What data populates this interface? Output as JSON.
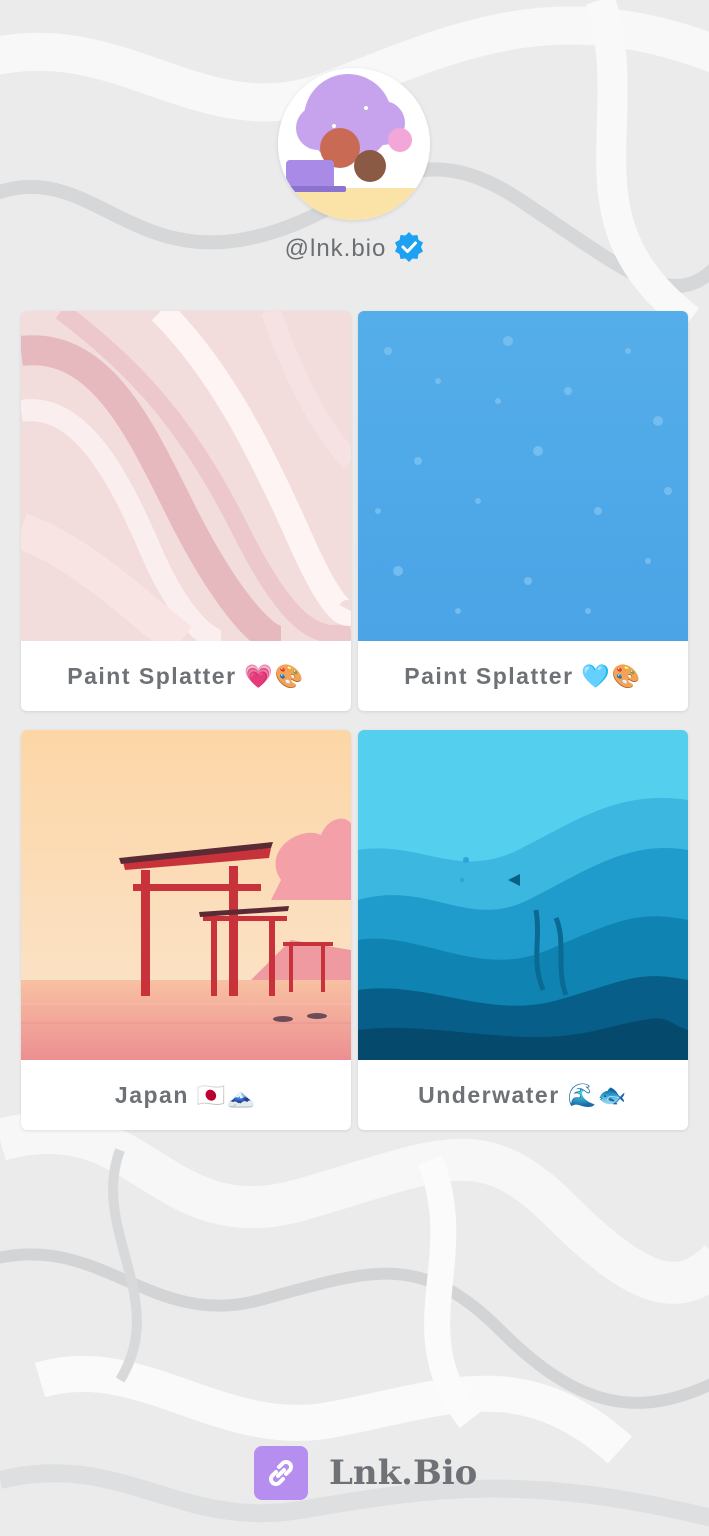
{
  "profile": {
    "handle": "@lnk.bio",
    "verified": true,
    "avatar_icon": "avatar-illustration-icon"
  },
  "cards": [
    {
      "label": "Paint Splatter 💗🎨",
      "thumb": "pink-marble-thumbnail"
    },
    {
      "label": "Paint Splatter 🩵🎨",
      "thumb": "blue-splatter-thumbnail"
    },
    {
      "label": "Japan 🇯🇵🗻",
      "thumb": "torii-gate-thumbnail"
    },
    {
      "label": "Underwater 🌊🐟",
      "thumb": "underwater-thumbnail"
    }
  ],
  "footer": {
    "brand": "Lnk.Bio",
    "logo_icon": "link-icon"
  },
  "colors": {
    "text_gray": "#6e7276",
    "verified_blue": "#1da1f2",
    "brand_purple": "#b58ef0"
  }
}
